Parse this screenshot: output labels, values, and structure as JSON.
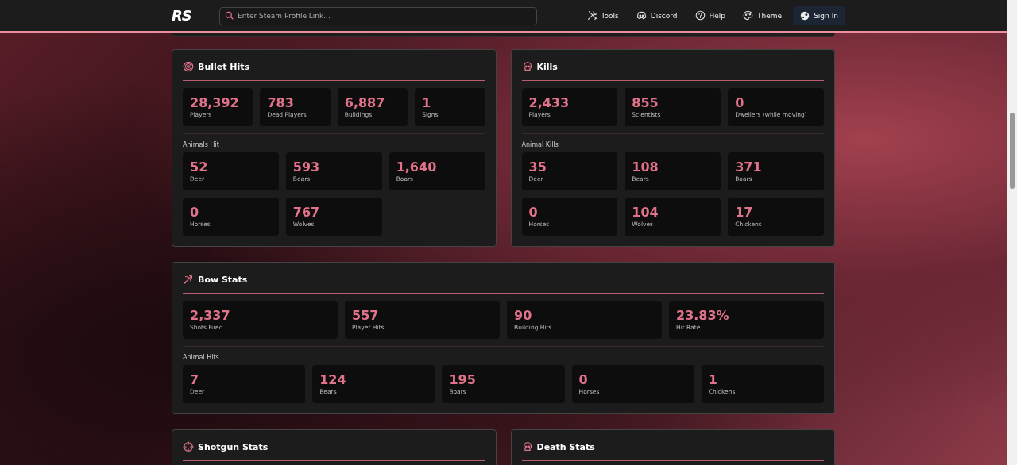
{
  "header": {
    "logo": "RS",
    "search": {
      "placeholder": "Enter Steam Profile Link..."
    },
    "nav": [
      {
        "label": "Tools",
        "kind": "tools"
      },
      {
        "label": "Discord",
        "kind": "discord"
      },
      {
        "label": "Help",
        "kind": "help"
      },
      {
        "label": "Theme",
        "kind": "theme"
      }
    ],
    "sign_in": {
      "label": "Sign In"
    }
  },
  "rows": [
    {
      "cards": [
        {
          "title": "Bullet Hits",
          "kind": "target",
          "stats": [
            {
              "value": "28,392",
              "label": "Players"
            },
            {
              "value": "783",
              "label": "Dead Players"
            },
            {
              "value": "6,887",
              "label": "Buildings"
            },
            {
              "value": "1",
              "label": "Signs"
            }
          ],
          "group": {
            "label": "Animals Hit",
            "stats": [
              {
                "value": "52",
                "label": "Deer"
              },
              {
                "value": "593",
                "label": "Bears"
              },
              {
                "value": "1,640",
                "label": "Boars"
              },
              {
                "value": "0",
                "label": "Horses"
              },
              {
                "value": "767",
                "label": "Wolves"
              }
            ]
          }
        },
        {
          "title": "Kills",
          "kind": "skull",
          "stats": [
            {
              "value": "2,433",
              "label": "Players"
            },
            {
              "value": "855",
              "label": "Scientists"
            },
            {
              "value": "0",
              "label": "Dwellers (while moving)"
            }
          ],
          "group": {
            "label": "Animal Kills",
            "stats": [
              {
                "value": "35",
                "label": "Deer"
              },
              {
                "value": "108",
                "label": "Bears"
              },
              {
                "value": "371",
                "label": "Boars"
              },
              {
                "value": "0",
                "label": "Horses"
              },
              {
                "value": "104",
                "label": "Wolves"
              },
              {
                "value": "17",
                "label": "Chickens"
              }
            ]
          }
        }
      ]
    },
    {
      "cards": [
        {
          "title": "Bow Stats",
          "kind": "bow",
          "stats": [
            {
              "value": "2,337",
              "label": "Shots Fired"
            },
            {
              "value": "557",
              "label": "Player Hits"
            },
            {
              "value": "90",
              "label": "Building Hits"
            },
            {
              "value": "23.83%",
              "label": "Hit Rate"
            }
          ],
          "group": {
            "label": "Animal Hits",
            "stats": [
              {
                "value": "7",
                "label": "Deer"
              },
              {
                "value": "124",
                "label": "Bears"
              },
              {
                "value": "195",
                "label": "Boars"
              },
              {
                "value": "0",
                "label": "Horses"
              },
              {
                "value": "1",
                "label": "Chickens"
              }
            ]
          }
        }
      ]
    },
    {
      "cards": [
        {
          "title": "Shotgun Stats",
          "kind": "crosshair"
        },
        {
          "title": "Death Stats",
          "kind": "skull"
        }
      ]
    }
  ]
}
